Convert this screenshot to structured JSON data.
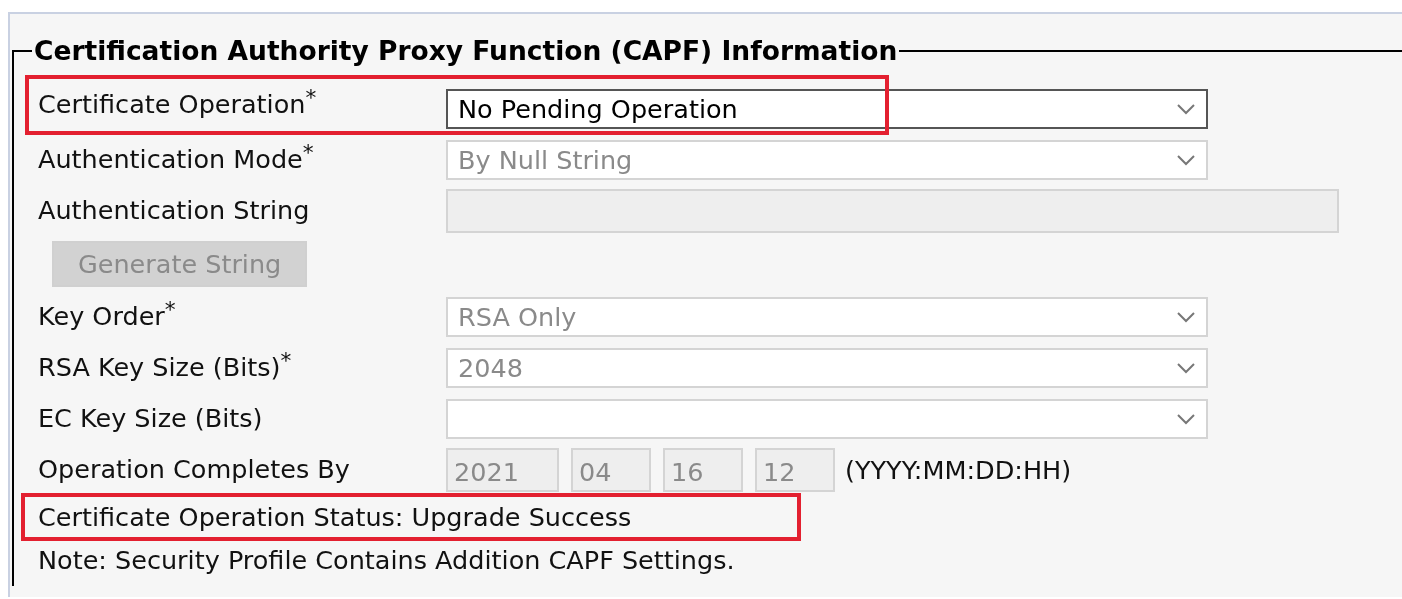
{
  "section": {
    "title": "Certification Authority Proxy Function (CAPF) Information"
  },
  "fields": [
    {
      "kind": "select",
      "label": "Certificate Operation$^{*}$",
      "value": "No Pending Operation",
      "disabled": false,
      "highlighted": true
    },
    {
      "kind": "select",
      "label": "Authentication Mode$^{*}$",
      "value": "By Null String",
      "disabled": true,
      "highlighted": false
    },
    {
      "kind": "text",
      "label": "Authentication String",
      "disabled": true,
      "highlighted": false
    },
    {
      "kind": "button",
      "label": "Generate String",
      "disabled": true,
      "highlighted": false
    },
    {
      "kind": "select",
      "label": "Key Order$^{*}$",
      "value": "RSA Only",
      "disabled": true,
      "highlighted": false
    },
    {
      "kind": "select",
      "label": "RSA Key Size (Bits)$^{*}$",
      "value": "2048",
      "disabled": true,
      "highlighted": false
    },
    {
      "kind": "select",
      "label": "EC Key Size (Bits)",
      "disabled": true,
      "highlighted": false
    },
    {
      "kind": "date",
      "label": "Operation Completes By",
      "parts": [
        "2021",
        "04",
        "16",
        "12"
      ],
      "hint": "(YYYY:MM:DD:HH)",
      "disabled": true,
      "highlighted": false
    }
  ],
  "status": {
    "text": "Certificate Operation Status: Upgrade Success",
    "highlighted": true
  },
  "note": "Note: Security Profile Contains Addition CAPF Settings."
}
